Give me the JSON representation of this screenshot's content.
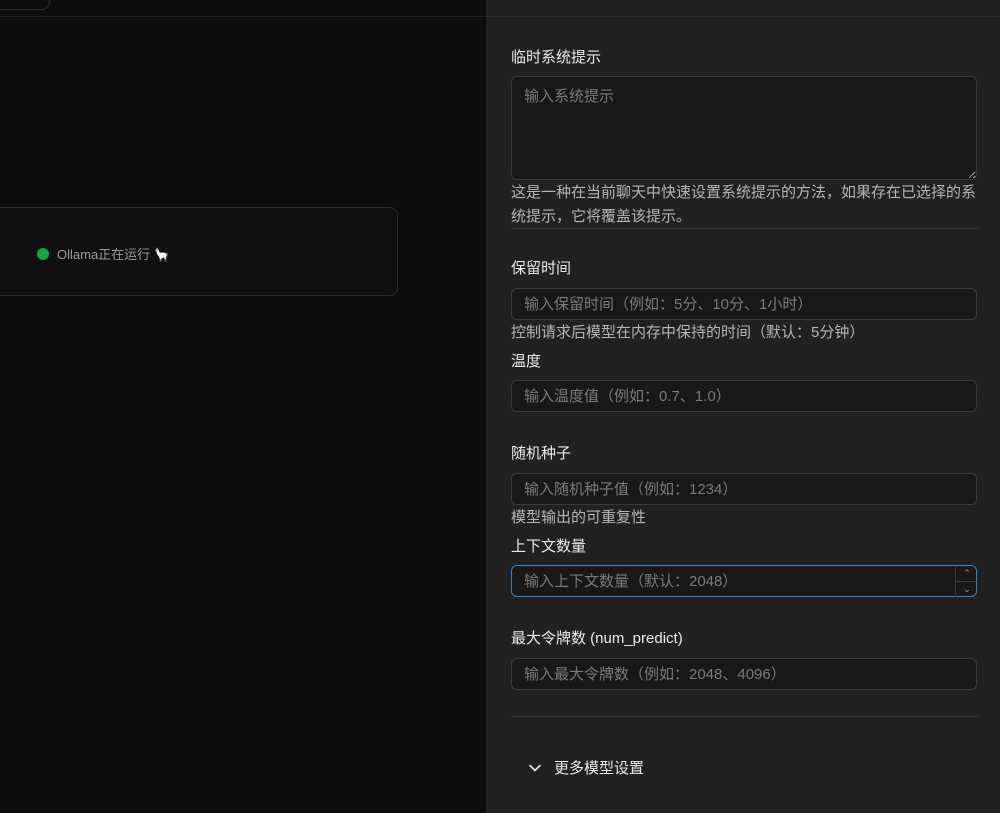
{
  "status": {
    "text": "Ollama正在运行 🦙"
  },
  "settings": {
    "system_prompt": {
      "label": "临时系统提示",
      "placeholder": "输入系统提示",
      "help": "这是一种在当前聊天中快速设置系统提示的方法，如果存在已选择的系统提示，它将覆盖该提示。"
    },
    "keep_alive": {
      "label": "保留时间",
      "placeholder": "输入保留时间（例如：5分、10分、1小时）",
      "help": "控制请求后模型在内存中保持的时间（默认：5分钟）"
    },
    "temperature": {
      "label": "温度",
      "placeholder": "输入温度值（例如：0.7、1.0）"
    },
    "seed": {
      "label": "随机种子",
      "placeholder": "输入随机种子值（例如：1234）",
      "help": "模型输出的可重复性"
    },
    "num_ctx": {
      "label": "上下文数量",
      "placeholder": "输入上下文数量（默认：2048）"
    },
    "num_predict": {
      "label": "最大令牌数 (num_predict)",
      "placeholder": "输入最大令牌数（例如：2048、4096）"
    },
    "more": {
      "label": "更多模型设置"
    }
  },
  "colors": {
    "status_dot": "#16a34a",
    "focus_border": "#3b82c4",
    "panel_bg": "#212121"
  }
}
